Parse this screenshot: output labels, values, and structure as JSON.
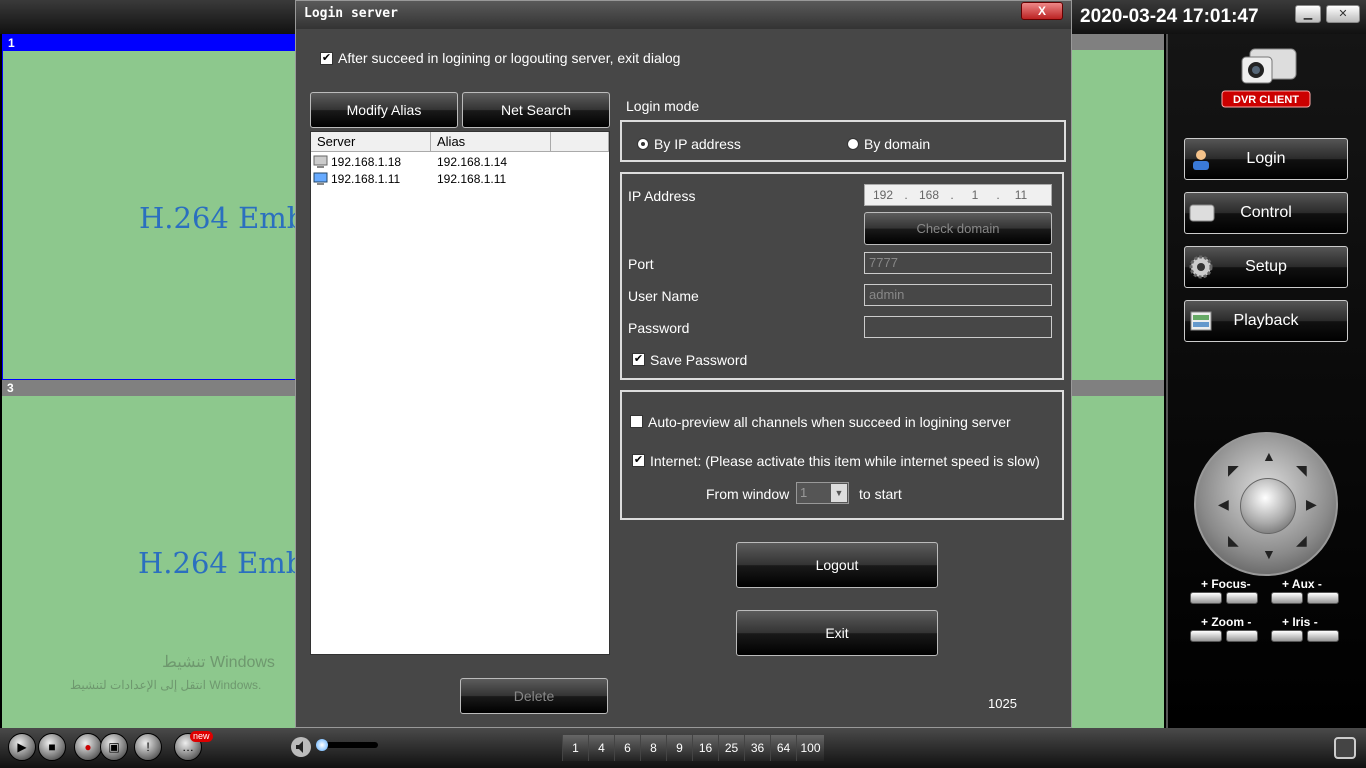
{
  "header": {
    "datetime": "2020-03-24 17:01:47",
    "minimize_icon": "minimize-icon",
    "close_icon": "close-icon"
  },
  "panes": [
    {
      "number": "1",
      "text": "H.264 Emb",
      "header_color": "#0000ff"
    },
    {
      "number": "3",
      "text": "H.264 Emb",
      "header_color": "#808080"
    }
  ],
  "watermark": {
    "line1": "تنشيط Windows",
    "line2": "انتقل إلى الإعدادات لتنشيط Windows."
  },
  "sidebar": {
    "logo_text": "DVR CLIENT",
    "items": [
      {
        "label": "Login",
        "icon": "user-icon"
      },
      {
        "label": "Control",
        "icon": "device-icon"
      },
      {
        "label": "Setup",
        "icon": "gear-icon"
      },
      {
        "label": "Playback",
        "icon": "film-icon"
      }
    ]
  },
  "ptz": {
    "focus": "+ Focus-",
    "aux": "+ Aux  -",
    "zoom": "+ Zoom -",
    "iris": "+ Iris -"
  },
  "bottombar": {
    "new_badge": "new",
    "splits": [
      "1",
      "4",
      "6",
      "8",
      "9",
      "16",
      "25",
      "36",
      "64",
      "100"
    ]
  },
  "dialog": {
    "title": "Login server",
    "close_label": "X",
    "exit_after_label": "After succeed in logining or logouting server, exit dialog",
    "exit_after_checked": true,
    "modify_alias": "Modify Alias",
    "net_search": "Net Search",
    "columns": [
      "Server",
      "Alias"
    ],
    "servers": [
      {
        "server": "192.168.1.18",
        "alias": "192.168.1.14"
      },
      {
        "server": "192.168.1.11",
        "alias": "192.168.1.11"
      }
    ],
    "delete": "Delete",
    "login_mode_label": "Login mode",
    "by_ip": "By IP address",
    "by_domain": "By domain",
    "ip_address_label": "IP Address",
    "ip": [
      "192",
      "168",
      "1",
      "11"
    ],
    "check_domain": "Check domain",
    "port_label": "Port",
    "port_value": "7777",
    "username_label": "User Name",
    "username_value": "admin",
    "password_label": "Password",
    "password_value": "",
    "save_password": "Save Password",
    "auto_preview": "Auto-preview all channels when succeed in logining server",
    "internet": "Internet: (Please activate this item while internet speed is slow)",
    "from_window": "From window",
    "from_window_value": "1",
    "to_start": "to start",
    "logout": "Logout",
    "exit": "Exit",
    "code": "1025"
  }
}
